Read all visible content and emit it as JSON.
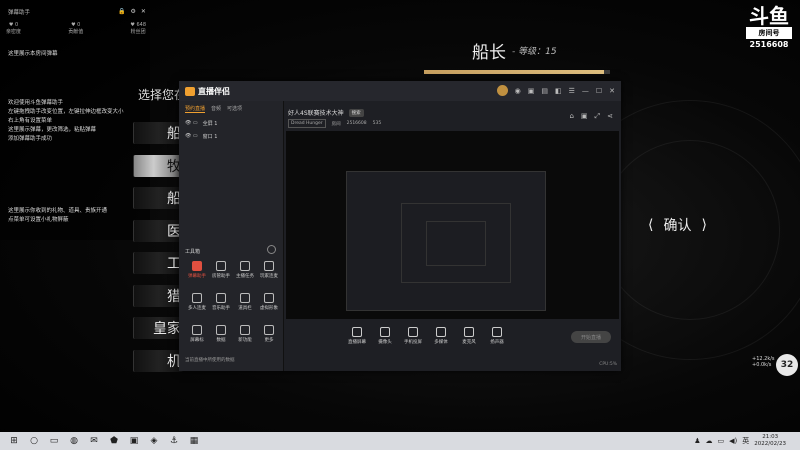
{
  "helper": {
    "title": "弹幕助手",
    "controls": [
      "🔒",
      "⚙",
      "✕"
    ],
    "stats": [
      {
        "icon": "♥",
        "value": "0",
        "label": "亲密度"
      },
      {
        "icon": "♥",
        "value": "0",
        "label": "贡献值"
      },
      {
        "icon": "♥",
        "value": "648",
        "label": "粉丝团"
      }
    ],
    "lines": [
      "这里展示本房间弹幕",
      "欢迎使用斗鱼弹幕助手",
      "左键拖拽助手改变位置，左键拉伸边框改变大小",
      "右上角有设置菜单",
      "这里展示弹幕，更改筛选，粘贴弹幕",
      "添加弹幕助手成功",
      "这里展示你收到的礼物、道具、贵族开通",
      "点菜单可设置小礼物屏蔽"
    ]
  },
  "game": {
    "choose_title": "选择您在",
    "menu": [
      "船",
      "牧",
      "船",
      "医",
      "工",
      "猎",
      "皇家",
      "机"
    ],
    "selected_index": 1,
    "captain": "船长",
    "level": "- 等级：15",
    "level_progress": 0.97,
    "confirm": "确认",
    "confirm_arrows": [
      "⟨",
      "⟩"
    ]
  },
  "logo": {
    "big": "斗鱼",
    "tag": "房间号",
    "room": "2516608"
  },
  "fps": {
    "text": "+12.2k/s\n+0.0k/s",
    "badge": "32"
  },
  "app": {
    "name": "直播伴侣",
    "right_icons": [
      "◉",
      "▣",
      "▤",
      "◧",
      "☰",
      "—",
      "☐",
      "✕"
    ],
    "tabs": [
      "预约直播",
      "音频",
      "可选项"
    ],
    "active_tab": 0,
    "scenes": [
      {
        "icons": "👁 ▭",
        "name": "全屏 1"
      },
      {
        "icons": "👁 ▭",
        "name": "窗口 1"
      }
    ],
    "tools_title": "工具箱",
    "tools": [
      {
        "label": "弹幕助手",
        "hot": true
      },
      {
        "label": "房管助手",
        "hot": false
      },
      {
        "label": "主播任务",
        "hot": false
      },
      {
        "label": "玩家连麦",
        "hot": false
      },
      {
        "label": "多人连麦",
        "hot": false
      },
      {
        "label": "音乐助手",
        "hot": false
      },
      {
        "label": "道具栏",
        "hot": false
      },
      {
        "label": "虚拟形象",
        "hot": false
      },
      {
        "label": "屏幕标",
        "hot": false
      },
      {
        "label": "数据",
        "hot": false
      },
      {
        "label": "新功能",
        "hot": false
      },
      {
        "label": "更多",
        "hot": false
      }
    ],
    "left_status": "当前直播中所使用的数据",
    "room_title": "好人4S联赛技术大神",
    "room_tag": "搜索",
    "room_meta": {
      "category": "Dread Hunger",
      "label": "房间",
      "room": "2516608",
      "views": "535"
    },
    "room_icons": [
      "⌂",
      "▣",
      "⤢",
      "⋖"
    ],
    "bottom": [
      "直播屏幕",
      "摄像头",
      "手机投屏",
      "多媒体",
      "麦克风",
      "扬声器"
    ],
    "start_label": "开始直播",
    "status": "CPU:5%"
  },
  "taskbar": {
    "icons": [
      "⊞",
      "○",
      "▭",
      "◍",
      "✉",
      "⬟",
      "▣",
      "◈",
      "⚓",
      "▦"
    ],
    "tray": [
      "♟",
      "☁",
      "▭",
      "◀)",
      "英"
    ],
    "time": "21:03",
    "date": "2022/02/23"
  }
}
